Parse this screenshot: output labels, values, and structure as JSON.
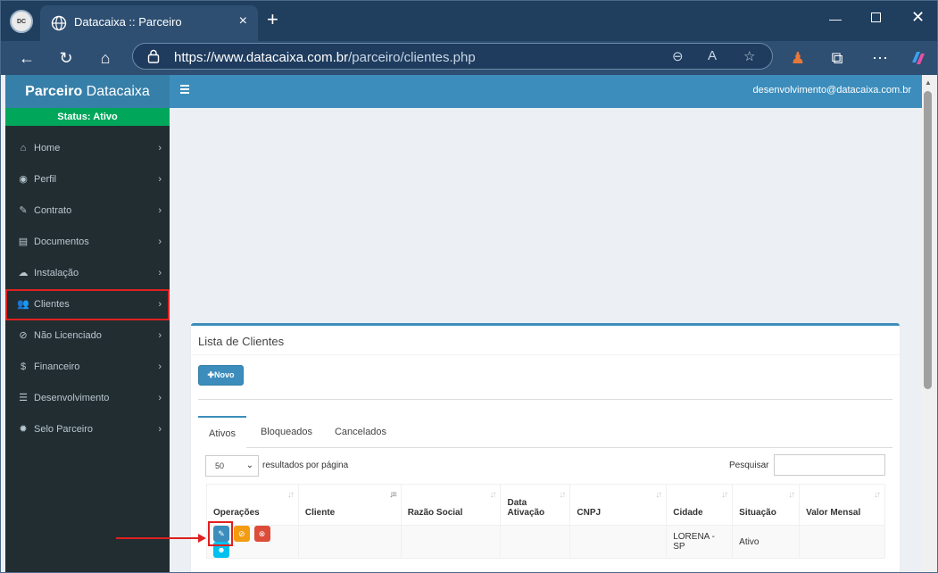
{
  "browser": {
    "tab_title": "Datacaixa :: Parceiro",
    "profile_label": "DC",
    "new_tab": "+",
    "url_host": "https://www.datacaixa.com.br",
    "url_path": "/parceiro/clientes.php"
  },
  "page": {
    "brand_bold": "Parceiro",
    "brand_rest": " Datacaixa",
    "status": "Status: Ativo",
    "user_email": "desenvolvimento@datacaixa.com.br"
  },
  "menu": [
    {
      "label": "Home",
      "icon": "home-icon",
      "glyph": "⌂"
    },
    {
      "label": "Perfil",
      "icon": "eye-icon",
      "glyph": "◉"
    },
    {
      "label": "Contrato",
      "icon": "edit-icon",
      "glyph": "✎"
    },
    {
      "label": "Documentos",
      "icon": "book-icon",
      "glyph": "▤"
    },
    {
      "label": "Instalação",
      "icon": "cloud-download-icon",
      "glyph": "☁"
    },
    {
      "label": "Clientes",
      "icon": "users-icon",
      "glyph": "👥"
    },
    {
      "label": "Não Licenciado",
      "icon": "ban-icon",
      "glyph": "⊘"
    },
    {
      "label": "Financeiro",
      "icon": "dollar-icon",
      "glyph": "$"
    },
    {
      "label": "Desenvolvimento",
      "icon": "server-icon",
      "glyph": "☰"
    },
    {
      "label": "Selo Parceiro",
      "icon": "certificate-icon",
      "glyph": "✹"
    }
  ],
  "clientes": {
    "title": "Lista de Clientes",
    "new_button": "Novo",
    "tabs": [
      "Ativos",
      "Bloqueados",
      "Cancelados"
    ],
    "page_length": "50",
    "page_length_label": "resultados por página",
    "search_label": "Pesquisar",
    "columns": [
      "Operações",
      "Cliente",
      "Razão Social",
      "Data Ativação",
      "CNPJ",
      "Cidade",
      "Situação",
      "Valor Mensal"
    ],
    "columns_line1": [
      "",
      "",
      "",
      "Data",
      "",
      "",
      "",
      ""
    ],
    "columns_line2": [
      "Operações",
      "Cliente",
      "Razão Social",
      "Ativação",
      "CNPJ",
      "Cidade",
      "Situação",
      "Valor Mensal"
    ],
    "rows": [
      {
        "cliente": "",
        "razao_social": "",
        "data_ativacao": "",
        "cnpj": "",
        "cidade": "LORENA - SP",
        "situacao": "Ativo",
        "valor_mensal": ""
      }
    ]
  },
  "colors": {
    "primary": "#3c8dbc",
    "sidebar": "#222d32",
    "status_green": "#00a65a",
    "highlight_red": "#e02020"
  }
}
